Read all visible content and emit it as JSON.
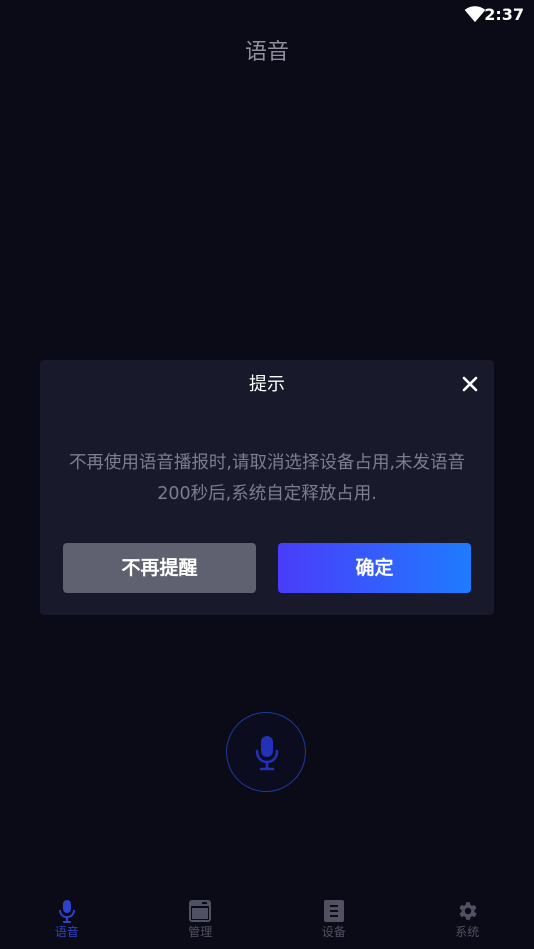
{
  "status_bar": {
    "time": "2:37",
    "wifi_icon": "wifi-icon"
  },
  "header": {
    "title": "语音"
  },
  "dialog": {
    "title": "提示",
    "close_icon": "close-icon",
    "message": "不再使用语音播报时,请取消选择设备占用,未发语音200秒后,系统自定释放占用.",
    "dismiss_label": "不再提醒",
    "confirm_label": "确定"
  },
  "mic": {
    "icon": "microphone-icon"
  },
  "bottom_nav": {
    "items": [
      {
        "label": "语音",
        "icon": "microphone-icon",
        "active": true
      },
      {
        "label": "管理",
        "icon": "browser-window-icon",
        "active": false
      },
      {
        "label": "设备",
        "icon": "document-list-icon",
        "active": false
      },
      {
        "label": "系统",
        "icon": "gear-icon",
        "active": false
      }
    ]
  },
  "colors": {
    "background": "#0a0b16",
    "dialog_background": "#181a2c",
    "dismiss_button": "#5f6171",
    "confirm_gradient_start": "#4a3cfa",
    "confirm_gradient_end": "#1f7bff",
    "active_nav": "#2c43c8",
    "inactive_nav": "#505264"
  }
}
